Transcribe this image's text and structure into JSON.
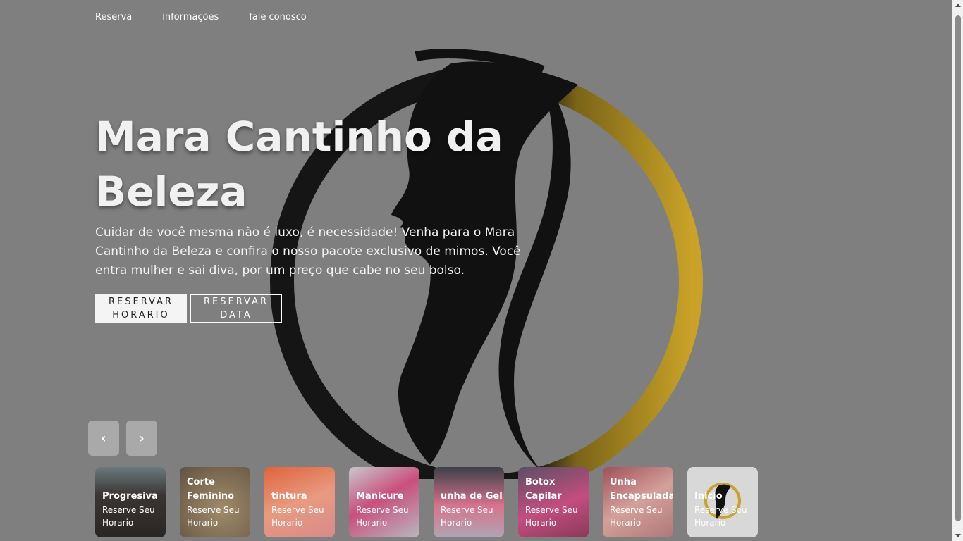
{
  "nav": {
    "items": [
      {
        "label": "Reserva"
      },
      {
        "label": "informações"
      },
      {
        "label": "fale conosco"
      }
    ]
  },
  "hero": {
    "title": "Mara Cantinho da Beleza",
    "description": "Cuidar de você mesma não é luxo, é necessidade! Venha para o Mara Cantinho da Beleza e confira o nosso pacote exclusivo de mimos. Você entra mulher e sai diva, por um preço que cabe no seu bolso.",
    "btn_primary": "RESERVAR HORARIO",
    "btn_secondary": "RESERVAR DATA"
  },
  "carousel": {
    "prev_icon": "chevron-left-icon",
    "next_icon": "chevron-right-icon",
    "prev_glyph": "‹",
    "next_glyph": "›"
  },
  "thumbnails": [
    {
      "title": "Progresiva",
      "subtitle": "Reserve Seu Horario"
    },
    {
      "title": "Corte Feminino",
      "subtitle": "Reserve Seu Horario"
    },
    {
      "title": "tintura",
      "subtitle": "Reserve Seu Horario"
    },
    {
      "title": "Manicure",
      "subtitle": "Reserve Seu Horario"
    },
    {
      "title": "unha de Gel",
      "subtitle": "Reserve Seu Horario"
    },
    {
      "title": "Botox Capilar",
      "subtitle": "Reserve Seu Horario"
    },
    {
      "title": "Unha Encapsulada",
      "subtitle": "Reserve Seu Horario"
    },
    {
      "title": "Inicio",
      "subtitle": "Reserve Seu Horario"
    }
  ],
  "colors": {
    "background": "#7f7f7f",
    "logo_ring_gold": "#c9a227",
    "logo_silhouette": "#111111"
  }
}
